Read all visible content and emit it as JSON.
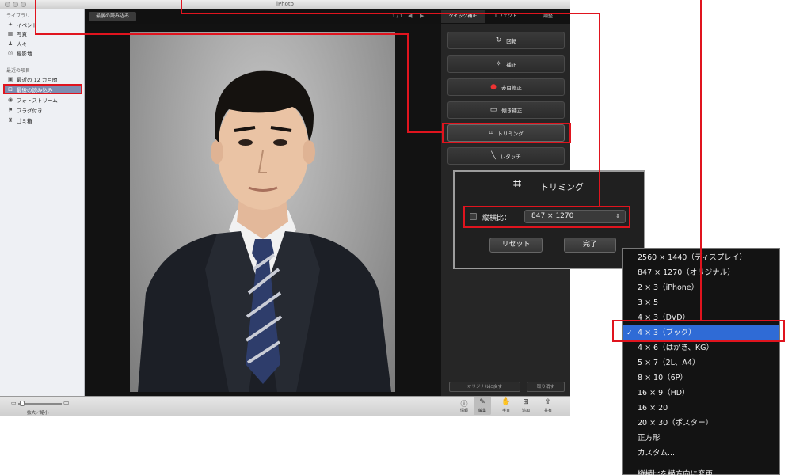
{
  "window": {
    "title": "iPhoto"
  },
  "sidebar": {
    "library_heading": "ライブラリ",
    "library_items": [
      {
        "label": "イベント",
        "icon": "events-icon"
      },
      {
        "label": "写真",
        "icon": "photos-icon"
      },
      {
        "label": "人々",
        "icon": "faces-icon"
      },
      {
        "label": "撮影地",
        "icon": "places-icon"
      }
    ],
    "recent_heading": "最近の項目",
    "recent_items": [
      {
        "label": "最近の 12 カ月間",
        "icon": "calendar-icon"
      },
      {
        "label": "最後の読み込み",
        "icon": "import-icon",
        "selected": true
      },
      {
        "label": "フォトストリーム",
        "icon": "photostream-icon"
      },
      {
        "label": "フラグ付き",
        "icon": "flag-icon"
      },
      {
        "label": "ゴミ箱",
        "icon": "trash-icon"
      }
    ]
  },
  "topbar": {
    "album_name": "最後の読み込み",
    "counter": "1 / 1",
    "tabs": [
      {
        "label": "クイック補正",
        "active": true
      },
      {
        "label": "エフェクト",
        "active": false
      },
      {
        "label": "調整",
        "active": false
      }
    ]
  },
  "panel": {
    "buttons": [
      {
        "label": "回転",
        "icon": "rotate-icon"
      },
      {
        "label": "補正",
        "icon": "enhance-icon"
      },
      {
        "label": "赤目修正",
        "icon": "red-eye-icon"
      },
      {
        "label": "傾き補正",
        "icon": "straighten-icon"
      },
      {
        "label": "トリミング",
        "icon": "crop-icon",
        "selected": true
      },
      {
        "label": "レタッチ",
        "icon": "retouch-icon"
      }
    ],
    "revert_label": "オリジナルに戻す",
    "undo_label": "取り消す"
  },
  "bottombar": {
    "zoom_label": "拡大／縮小",
    "zoom_level": 0.05,
    "tools": [
      {
        "label": "情報",
        "icon": "info-icon"
      },
      {
        "label": "編集",
        "icon": "edit-icon",
        "active": true
      },
      {
        "label": "手直",
        "icon": "hand-icon"
      },
      {
        "label": "追加",
        "icon": "add-icon"
      },
      {
        "label": "共有",
        "icon": "share-icon"
      }
    ]
  },
  "trim_popup": {
    "title": "トリミング",
    "ratio_label": "縦横比：",
    "ratio_checked": false,
    "ratio_value": "847 × 1270",
    "reset_label": "リセット",
    "done_label": "完了"
  },
  "ratio_menu": {
    "items": [
      "2560 × 1440（ディスプレイ）",
      "847 × 1270（オリジナル）",
      "2 × 3（iPhone）",
      "3 × 5",
      "4 × 3（DVD）",
      "4 × 3（ブック）",
      "4 × 6（はがき、KG）",
      "5 × 7（2L、A4）",
      "8 × 10（6P）",
      "16 × 9（HD）",
      "16 × 20",
      "20 × 30（ポスター）",
      "正方形",
      "カスタム..."
    ],
    "selected": "4 × 3（ブック）",
    "footer_item": "縦横比を横方向に変更"
  },
  "colors": {
    "callout_red": "#e0141e",
    "menu_highlight": "#2f6bd6"
  }
}
